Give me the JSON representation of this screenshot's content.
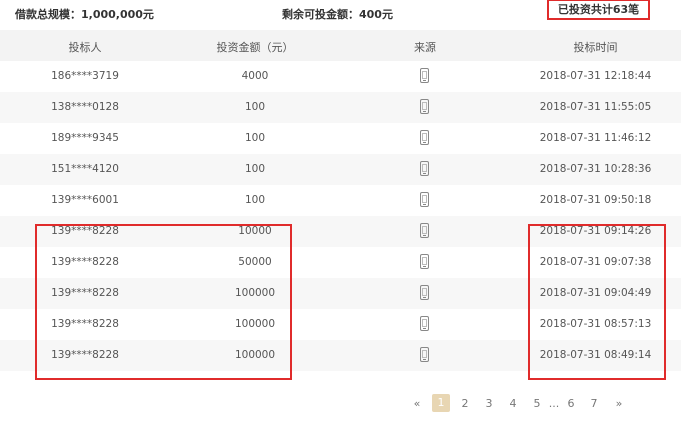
{
  "summary": {
    "total": "借款总规模：1,000,000元",
    "remaining": "剩余可投金额：400元",
    "count": "已投资共计63笔"
  },
  "table": {
    "headers": [
      "投标人",
      "投资金额（元）",
      "来源",
      "投标时间"
    ],
    "rows": [
      {
        "investor": "186****3719",
        "amount": "4000",
        "source": "phone-icon",
        "time": "2018-07-31 12:18:44"
      },
      {
        "investor": "138****0128",
        "amount": "100",
        "source": "phone-icon",
        "time": "2018-07-31 11:55:05"
      },
      {
        "investor": "189****9345",
        "amount": "100",
        "source": "phone-icon",
        "time": "2018-07-31 11:46:12"
      },
      {
        "investor": "151****4120",
        "amount": "100",
        "source": "phone-icon",
        "time": "2018-07-31 10:28:36"
      },
      {
        "investor": "139****6001",
        "amount": "100",
        "source": "phone-icon",
        "time": "2018-07-31 09:50:18"
      },
      {
        "investor": "139****8228",
        "amount": "10000",
        "source": "phone-icon",
        "time": "2018-07-31 09:14:26"
      },
      {
        "investor": "139****8228",
        "amount": "50000",
        "source": "phone-icon",
        "time": "2018-07-31 09:07:38"
      },
      {
        "investor": "139****8228",
        "amount": "100000",
        "source": "phone-icon",
        "time": "2018-07-31 09:04:49"
      },
      {
        "investor": "139****8228",
        "amount": "100000",
        "source": "phone-icon",
        "time": "2018-07-31 08:57:13"
      },
      {
        "investor": "139****8228",
        "amount": "100000",
        "source": "phone-icon",
        "time": "2018-07-31 08:49:14"
      }
    ]
  },
  "pagination": {
    "prev": "«",
    "pages": [
      "1",
      "2",
      "3",
      "4",
      "5",
      "...",
      "6",
      "7"
    ],
    "next": "»",
    "current": "1"
  },
  "highlight_color": "#e02b2b",
  "accent_color": "#e8d6b3"
}
